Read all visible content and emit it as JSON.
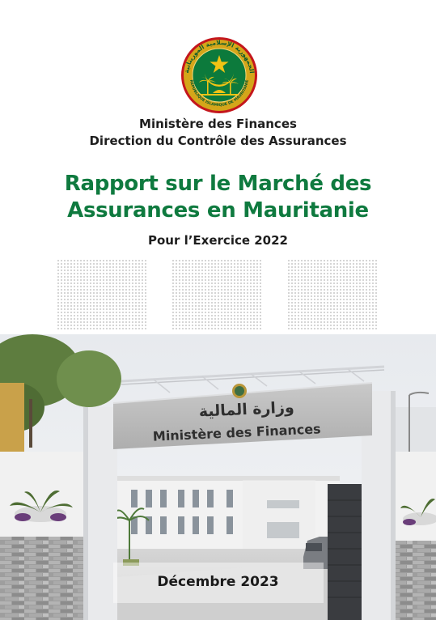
{
  "seal": {
    "arabic_text": "الجمهورية الإسلامية الموريتانية",
    "french_text": "RÉPUBLIQUE ISLAMIQUE DE MAURITANIE",
    "colors": {
      "ring": "#d4a61a",
      "field": "#0c7a3c",
      "star": "#f2c314",
      "border_red": "#c4161c"
    }
  },
  "header": {
    "ministry": "Ministère des Finances",
    "direction": "Direction du Contrôle des Assurances"
  },
  "report": {
    "title_line1": "Rapport sur le Marché des",
    "title_line2": "Assurances en Mauritanie",
    "subtitle": "Pour l’Exercice 2022"
  },
  "photo": {
    "sign_arabic": "وزارة المالية",
    "sign_french": "Ministère des Finances"
  },
  "footer": {
    "date": "Décembre 2023"
  },
  "colors": {
    "title_green": "#0f7a3f",
    "text_dark": "#1e1e1e"
  }
}
